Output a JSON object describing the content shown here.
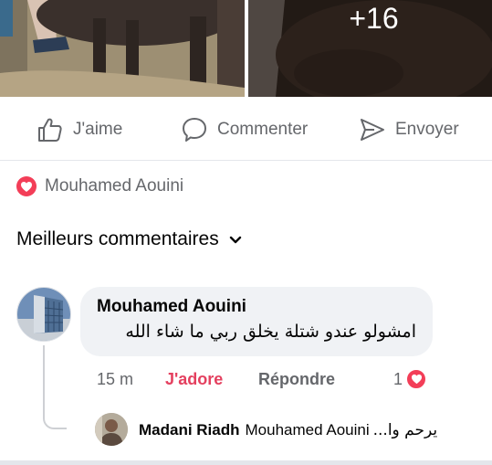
{
  "photos": {
    "more_count": "+16"
  },
  "actions": {
    "like_label": "J'aime",
    "comment_label": "Commenter",
    "send_label": "Envoyer"
  },
  "reactions": {
    "names": "Mouhamed Aouini"
  },
  "comments_filter": {
    "label": "Meilleurs commentaires"
  },
  "comment": {
    "author": "Mouhamed Aouini",
    "text": "امشولو عندو شتلة يخلق ربي ما شاء الله",
    "time": "15 m",
    "reaction_label": "J'adore",
    "reply_label": "Répondre",
    "reaction_count": "1"
  },
  "reply": {
    "author": "Madani Riadh",
    "mention": "Mouhamed Aouini",
    "preview": "يرحم وا..."
  },
  "colors": {
    "love_red": "#f33e58",
    "adore_text": "#e4405f",
    "secondary_text": "#65676b",
    "bubble_bg": "#f0f2f5"
  }
}
